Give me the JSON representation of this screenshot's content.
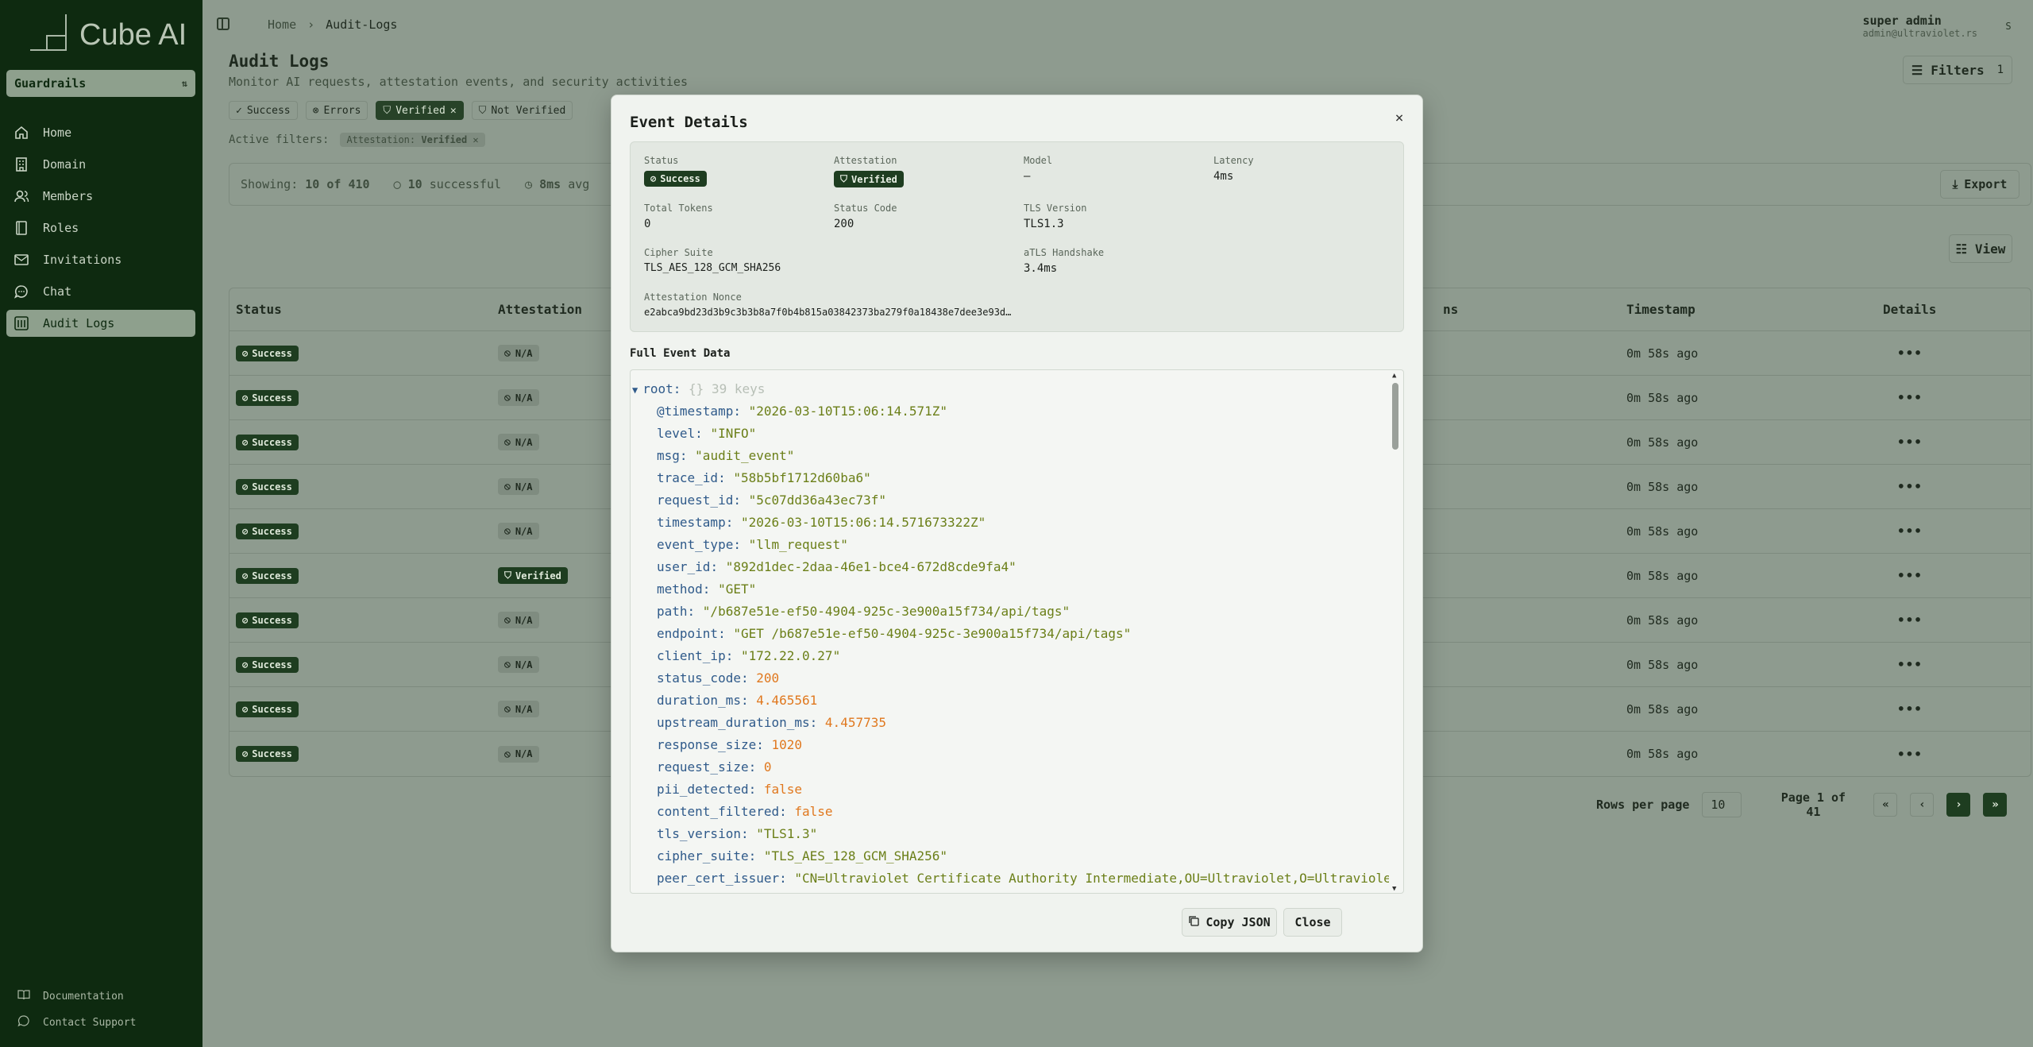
{
  "app": {
    "name": "Cube AI",
    "team": "Guardrails"
  },
  "sidebar": {
    "items": [
      {
        "label": "Home",
        "icon": "home-icon"
      },
      {
        "label": "Domain",
        "icon": "building-icon"
      },
      {
        "label": "Members",
        "icon": "users-icon"
      },
      {
        "label": "Roles",
        "icon": "book-icon"
      },
      {
        "label": "Invitations",
        "icon": "mail-icon"
      },
      {
        "label": "Chat",
        "icon": "chat-icon"
      },
      {
        "label": "Audit Logs",
        "icon": "audit-icon"
      }
    ],
    "active": "Audit Logs",
    "footer": {
      "docs": "Documentation",
      "support": "Contact Support"
    }
  },
  "header": {
    "breadcrumb": [
      "Home",
      "Audit-Logs"
    ],
    "user_name": "super admin",
    "user_email": "admin@ultraviolet.rs",
    "avatar": "S"
  },
  "page": {
    "title": "Audit Logs",
    "subtitle": "Monitor AI requests, attestation events, and security activities",
    "filters_label": "Filters",
    "filters_count": "1",
    "chips": [
      "Success",
      "Errors",
      "Verified",
      "Not Verified"
    ],
    "active_filters_label": "Active filters:",
    "active_filter_key": "Attestation:",
    "active_filter_value": "Verified",
    "showing_label": "Showing:",
    "showing_value": "10 of 410",
    "successful_count": "10",
    "successful_label": "successful",
    "avg_value": "8ms",
    "avg_label": "avg",
    "export_label": "Export",
    "view_label": "View"
  },
  "table": {
    "headers": {
      "status": "Status",
      "attestation": "Attestation",
      "tokens_partial": "ns",
      "timestamp": "Timestamp",
      "details": "Details"
    },
    "rows": [
      {
        "status": "Success",
        "attestation": "N/A",
        "timestamp": "0m 58s ago"
      },
      {
        "status": "Success",
        "attestation": "N/A",
        "timestamp": "0m 58s ago"
      },
      {
        "status": "Success",
        "attestation": "N/A",
        "timestamp": "0m 58s ago"
      },
      {
        "status": "Success",
        "attestation": "N/A",
        "timestamp": "0m 58s ago"
      },
      {
        "status": "Success",
        "attestation": "N/A",
        "timestamp": "0m 58s ago"
      },
      {
        "status": "Success",
        "attestation": "Verified",
        "timestamp": "0m 58s ago"
      },
      {
        "status": "Success",
        "attestation": "N/A",
        "timestamp": "0m 58s ago"
      },
      {
        "status": "Success",
        "attestation": "N/A",
        "timestamp": "0m 58s ago"
      },
      {
        "status": "Success",
        "attestation": "N/A",
        "timestamp": "0m 58s ago"
      },
      {
        "status": "Success",
        "attestation": "N/A",
        "timestamp": "0m 58s ago"
      }
    ],
    "details_glyph": "•••"
  },
  "pagination": {
    "rows_per_page_label": "Rows per page",
    "rows_per_page": "10",
    "page_line1": "Page 1 of",
    "page_line2": "41",
    "first": "«",
    "prev": "‹",
    "next": "›",
    "last": "»"
  },
  "modal": {
    "title": "Event Details",
    "close_x": "×",
    "summary": {
      "status_label": "Status",
      "status_value": "Success",
      "attestation_label": "Attestation",
      "attestation_value": "Verified",
      "model_label": "Model",
      "model_value": "—",
      "latency_label": "Latency",
      "latency_value": "4ms",
      "total_tokens_label": "Total Tokens",
      "total_tokens_value": "0",
      "status_code_label": "Status Code",
      "status_code_value": "200",
      "tls_version_label": "TLS Version",
      "tls_version_value": "TLS1.3",
      "cipher_label": "Cipher Suite",
      "cipher_value": "TLS_AES_128_GCM_SHA256",
      "atls_label": "aTLS Handshake",
      "atls_value": "3.4ms",
      "nonce_label": "Attestation Nonce",
      "nonce_value": "e2abca9bd23d3b9c3b3b8a7f0b4b815a03842373ba279f0a18438e7dee3e93d…"
    },
    "full_event_label": "Full Event Data",
    "json": {
      "root_label": "root:",
      "root_meta": "{} 39 keys",
      "lines": [
        {
          "key": "@timestamp",
          "value": "\"2026-03-10T15:06:14.571Z\"",
          "type": "str"
        },
        {
          "key": "level",
          "value": "\"INFO\"",
          "type": "str"
        },
        {
          "key": "msg",
          "value": "\"audit_event\"",
          "type": "str"
        },
        {
          "key": "trace_id",
          "value": "\"58b5bf1712d60ba6\"",
          "type": "str"
        },
        {
          "key": "request_id",
          "value": "\"5c07dd36a43ec73f\"",
          "type": "str"
        },
        {
          "key": "timestamp",
          "value": "\"2026-03-10T15:06:14.571673322Z\"",
          "type": "str"
        },
        {
          "key": "event_type",
          "value": "\"llm_request\"",
          "type": "str"
        },
        {
          "key": "user_id",
          "value": "\"892d1dec-2daa-46e1-bce4-672d8cde9fa4\"",
          "type": "str"
        },
        {
          "key": "method",
          "value": "\"GET\"",
          "type": "str"
        },
        {
          "key": "path",
          "value": "\"/b687e51e-ef50-4904-925c-3e900a15f734/api/tags\"",
          "type": "str"
        },
        {
          "key": "endpoint",
          "value": "\"GET /b687e51e-ef50-4904-925c-3e900a15f734/api/tags\"",
          "type": "str"
        },
        {
          "key": "client_ip",
          "value": "\"172.22.0.27\"",
          "type": "str"
        },
        {
          "key": "status_code",
          "value": "200",
          "type": "num"
        },
        {
          "key": "duration_ms",
          "value": "4.465561",
          "type": "num"
        },
        {
          "key": "upstream_duration_ms",
          "value": "4.457735",
          "type": "num"
        },
        {
          "key": "response_size",
          "value": "1020",
          "type": "num"
        },
        {
          "key": "request_size",
          "value": "0",
          "type": "num"
        },
        {
          "key": "pii_detected",
          "value": "false",
          "type": "bool"
        },
        {
          "key": "content_filtered",
          "value": "false",
          "type": "bool"
        },
        {
          "key": "tls_version",
          "value": "\"TLS1.3\"",
          "type": "str"
        },
        {
          "key": "cipher_suite",
          "value": "\"TLS_AES_128_GCM_SHA256\"",
          "type": "str"
        },
        {
          "key": "peer_cert_issuer",
          "value": "\"CN=Ultraviolet Certificate Authority Intermediate,OU=Ultraviolet,O=Ultraviole",
          "type": "str"
        }
      ]
    },
    "copy_label": "Copy JSON",
    "close_label": "Close"
  },
  "colors": {
    "sidebar_bg": "#0e2a10",
    "badge_green": "#1e3d20",
    "json_key": "#2f5a8a",
    "json_string": "#6b7f18",
    "json_number": "#e0781e"
  }
}
